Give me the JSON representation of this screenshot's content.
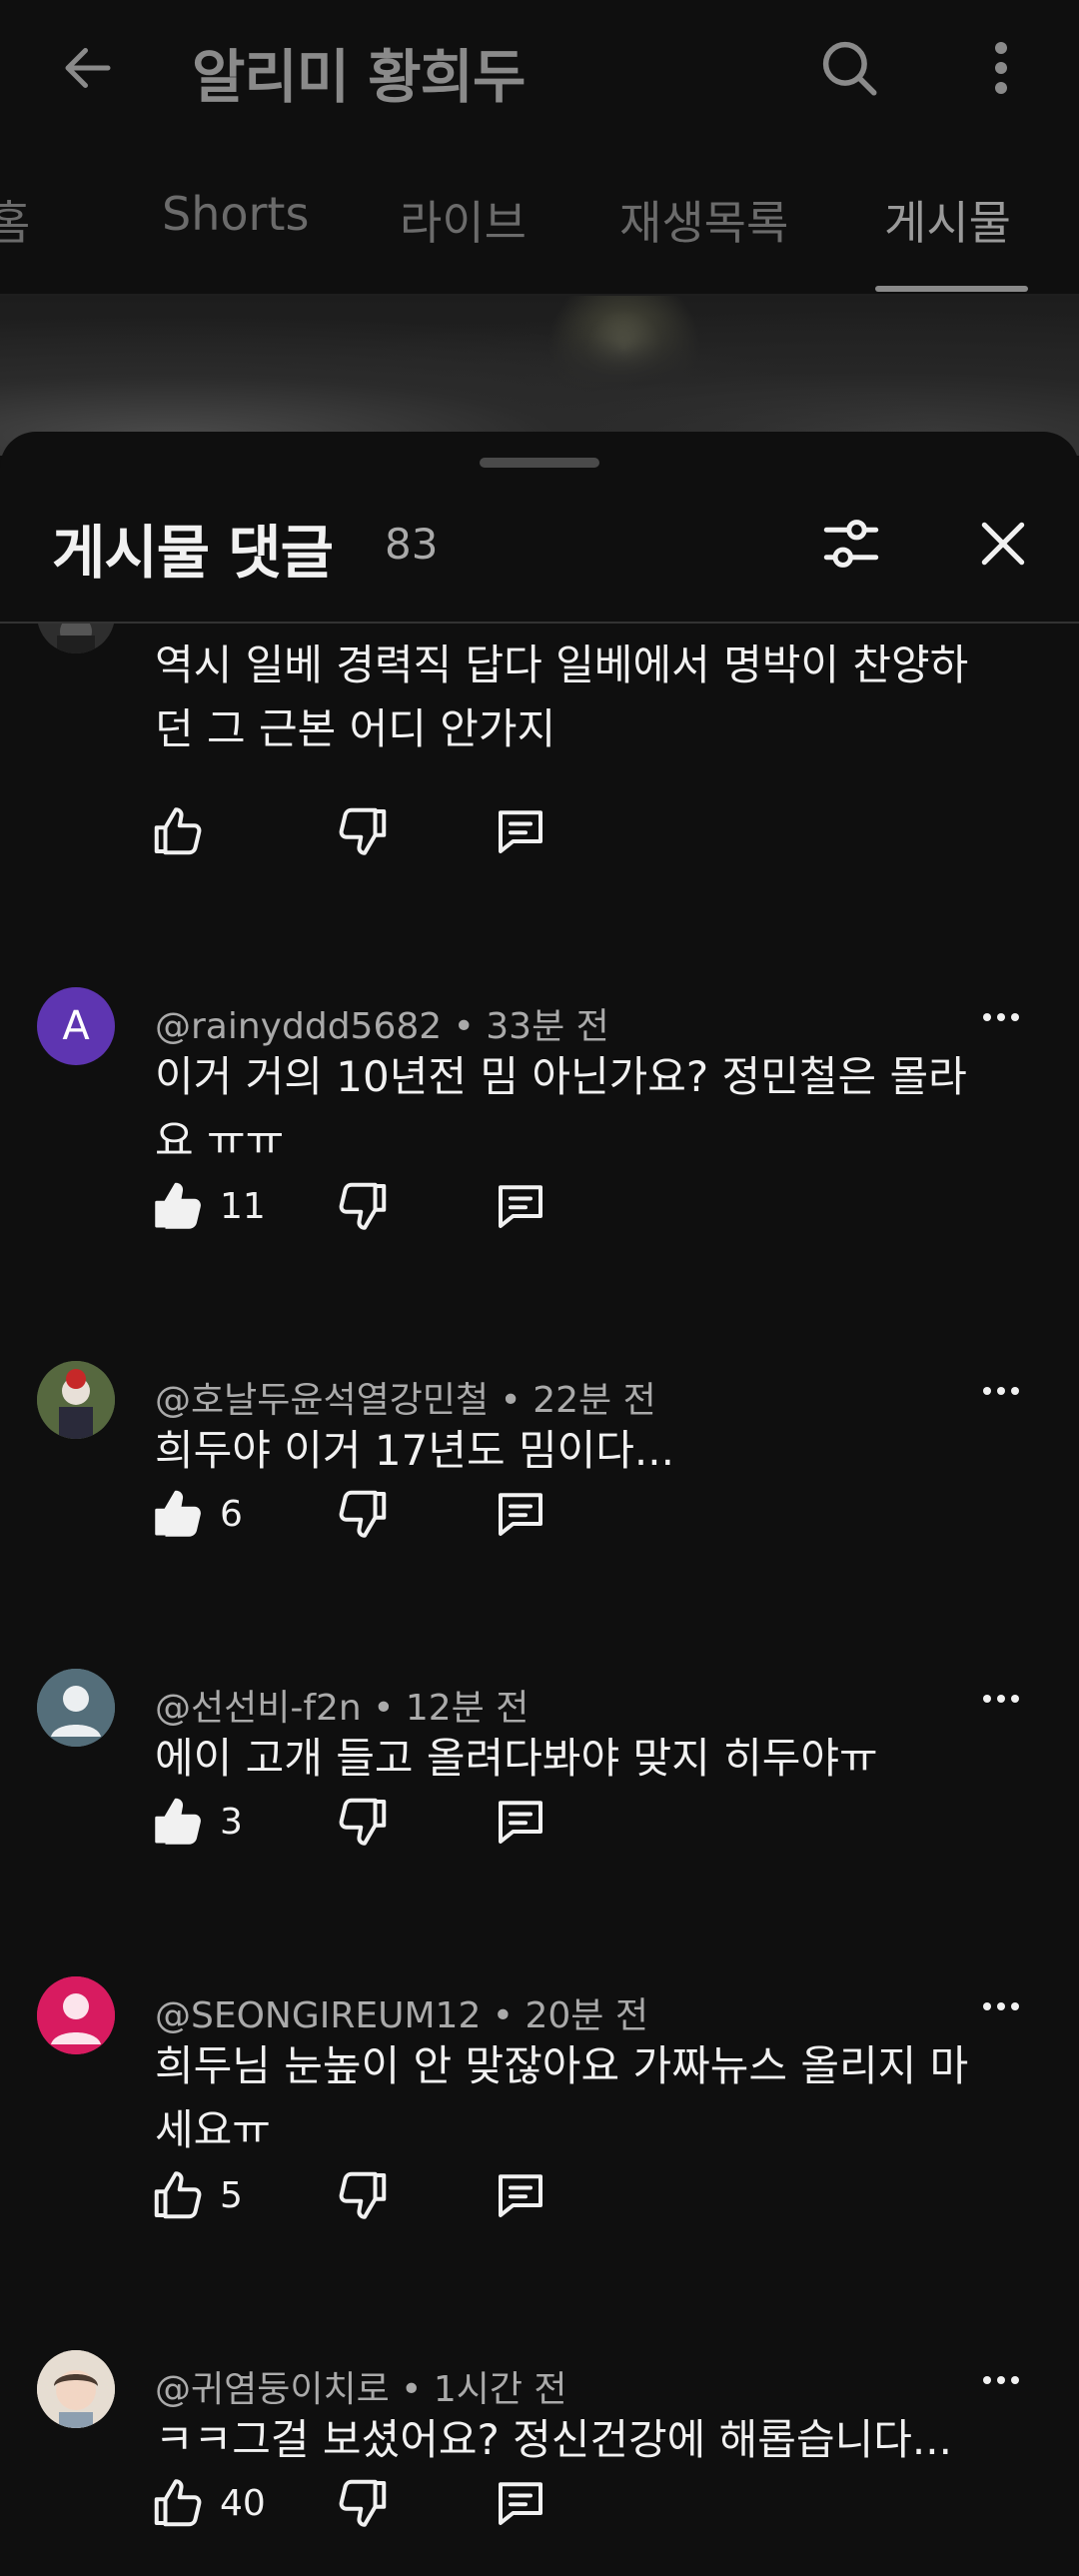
{
  "appbar": {
    "title": "알리미 황희두",
    "back_icon": "arrow-left-icon",
    "search_icon": "search-icon",
    "more_icon": "more-vertical-icon"
  },
  "tabs": [
    {
      "label": "홈",
      "active": false
    },
    {
      "label": "Shorts",
      "active": false
    },
    {
      "label": "라이브",
      "active": false
    },
    {
      "label": "재생목록",
      "active": false
    },
    {
      "label": "게시물",
      "active": true
    }
  ],
  "sheet": {
    "title": "게시물 댓글",
    "count": "83",
    "filter_icon": "sliders-icon",
    "close_icon": "close-icon"
  },
  "comments": [
    {
      "meta": "",
      "text": "역시 일베 경력직 답다 일베에서 명박이 찬양하던 그 근본 어디 안가지",
      "likes": "",
      "liked": false,
      "avatar": {
        "type": "photo",
        "color": "#3a3a3a"
      }
    },
    {
      "meta": "@rainyddd5682 • 33분 전",
      "text": "이거 거의 10년전 밈 아닌가요? 정민철은 몰라요 ㅠㅠ",
      "likes": "11",
      "liked": true,
      "avatar": {
        "type": "letter",
        "letter": "A",
        "color": "#5e35b1"
      }
    },
    {
      "meta": "@호날두윤석열강민철 • 22분 전",
      "text": "희두야 이거 17년도 밈이다...",
      "likes": "6",
      "liked": true,
      "avatar": {
        "type": "photo",
        "color": "#4b5a3c"
      }
    },
    {
      "meta": "@선선비-f2n • 12분 전",
      "text": "에이 고개 들고 올려다봐야 맞지 히두야ㅠ",
      "likes": "3",
      "liked": true,
      "avatar": {
        "type": "person",
        "color": "#546e7a"
      }
    },
    {
      "meta": "@SEONGIREUM12 • 20분 전",
      "text": "희두님 눈높이 안 맞잖아요 가짜뉴스 올리지 마세요ㅠ",
      "likes": "5",
      "liked": false,
      "avatar": {
        "type": "person",
        "color": "#d81b60"
      }
    },
    {
      "meta": "@귀염둥이치로 • 1시간 전",
      "text": "ㅋㅋ그걸 보셨어요? 정신건강에 해롭습니다...",
      "likes": "40",
      "liked": false,
      "avatar": {
        "type": "photo",
        "color": "#d9cfc4"
      }
    }
  ]
}
